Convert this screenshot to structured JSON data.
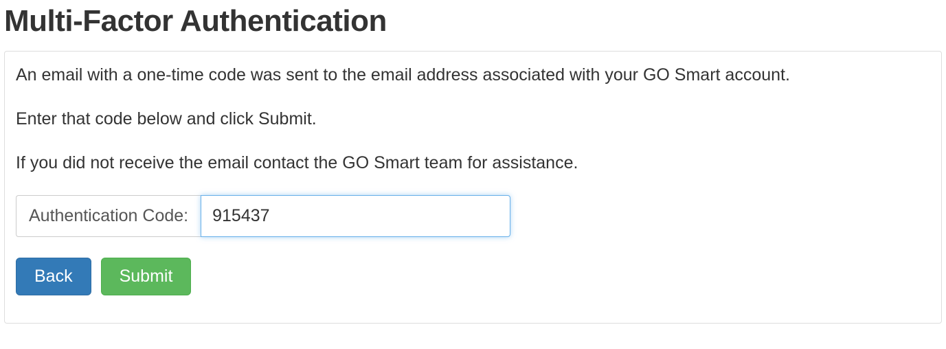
{
  "page": {
    "title": "Multi-Factor Authentication"
  },
  "panel": {
    "line1": "An email with a one-time code was sent to the email address associated with your GO Smart account.",
    "line2": "Enter that code below and click Submit.",
    "line3": "If you did not receive the email contact the GO Smart team for assistance."
  },
  "auth": {
    "label": "Authentication Code:",
    "value": "915437"
  },
  "buttons": {
    "back": "Back",
    "submit": "Submit"
  }
}
